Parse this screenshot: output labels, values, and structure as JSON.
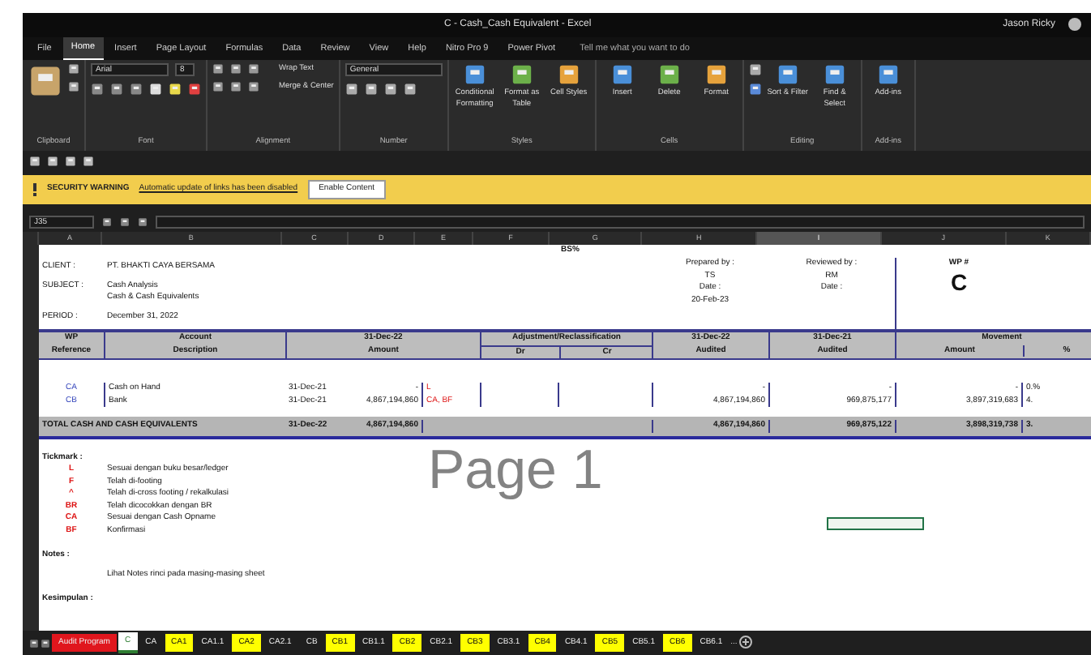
{
  "window": {
    "title": "C - Cash_Cash Equivalent - Excel",
    "user": "Jason Ricky"
  },
  "ribbon": {
    "tabs": [
      {
        "label": "File",
        "selected": false
      },
      {
        "label": "Home",
        "selected": true
      },
      {
        "label": "Insert",
        "selected": false
      },
      {
        "label": "Page Layout",
        "selected": false
      },
      {
        "label": "Formulas",
        "selected": false
      },
      {
        "label": "Data",
        "selected": false
      },
      {
        "label": "Review",
        "selected": false
      },
      {
        "label": "View",
        "selected": false
      },
      {
        "label": "Help",
        "selected": false
      },
      {
        "label": "Nitro Pro 9",
        "selected": false
      },
      {
        "label": "Power Pivot",
        "selected": false
      }
    ],
    "tell_me": "Tell me what you want to do",
    "font": "Arial",
    "font_size": "8",
    "number_format": "General",
    "groups": [
      {
        "label": "Clipboard",
        "kind": "clipboard"
      },
      {
        "label": "Font",
        "kind": "font"
      },
      {
        "label": "Alignment",
        "kind": "alignment",
        "buttons": [
          "Wrap Text",
          "Merge & Center"
        ]
      },
      {
        "label": "Number",
        "kind": "number"
      },
      {
        "label": "Styles",
        "kind": "big",
        "buttons": [
          "Conditional Formatting",
          "Format as Table",
          "Cell Styles"
        ]
      },
      {
        "label": "Cells",
        "kind": "big",
        "buttons": [
          "Insert",
          "Delete",
          "Format"
        ]
      },
      {
        "label": "Editing",
        "kind": "editing",
        "buttons": [
          "Sort & Filter",
          "Find & Select"
        ]
      },
      {
        "label": "Add-ins",
        "kind": "big",
        "buttons": [
          "Add-ins"
        ]
      }
    ]
  },
  "security_bar": {
    "title": "SECURITY WARNING",
    "message": "Automatic update of links has been disabled",
    "button": "Enable Content"
  },
  "name_box": "J35",
  "sheet": {
    "columns": [
      {
        "label": "A",
        "selected": false
      },
      {
        "label": "B",
        "selected": false
      },
      {
        "label": "C",
        "selected": false
      },
      {
        "label": "D",
        "selected": false
      },
      {
        "label": "E",
        "selected": false
      },
      {
        "label": "F",
        "selected": false
      },
      {
        "label": "G",
        "selected": false
      },
      {
        "label": "H",
        "selected": false
      },
      {
        "label": "I",
        "selected": true
      },
      {
        "label": "J",
        "selected": false
      },
      {
        "label": "K",
        "selected": false
      }
    ],
    "top_label": "BS%",
    "info": [
      {
        "label": "CLIENT :",
        "lines": [
          "PT. BHAKTI CAYA BERSAMA"
        ]
      },
      {
        "label": "SUBJECT :",
        "lines": [
          "Cash Analysis",
          "Cash & Cash Equivalents"
        ]
      },
      {
        "label": "PERIOD :",
        "lines": [
          "December 31, 2022"
        ]
      }
    ],
    "prepared": {
      "label": "Prepared by :",
      "name": "TS",
      "date_label": "Date :",
      "date": "20-Feb-23"
    },
    "reviewed": {
      "label": "Reviewed by :",
      "name": "RM",
      "date_label": "Date :"
    },
    "wp": {
      "label": "WP #",
      "value": "C"
    },
    "headers": {
      "ref": [
        "WP",
        "Reference"
      ],
      "desc": [
        "Account",
        "Description"
      ],
      "amount": [
        "31-Dec-22",
        "Amount"
      ],
      "adj": "Adjustment/Reclassification",
      "dr": "Dr",
      "cr": "Cr",
      "audited": [
        "31-Dec-22",
        "Audited"
      ],
      "prior": [
        "31-Dec-21",
        "Audited"
      ],
      "movement": "Movement",
      "mv_amount": "Amount",
      "mv_pct": "%"
    },
    "rows": [
      {
        "ref": "CA",
        "desc": "Cash on Hand",
        "date": "31-Dec-21",
        "amount": "-",
        "mark": "L",
        "audited": "-",
        "prior": "-",
        "movement": "-",
        "pct": "0.%"
      },
      {
        "ref": "CB",
        "desc": "Bank",
        "date": "31-Dec-21",
        "amount": "4,867,194,860",
        "mark": "CA, BF",
        "audited": "4,867,194,860",
        "prior": "969,875,177",
        "movement": "3,897,319,683",
        "pct": "4."
      }
    ],
    "total": {
      "label": "TOTAL CASH AND CASH EQUIVALENTS",
      "date": "31-Dec-22",
      "amount": "4,867,194,860",
      "audited": "4,867,194,860",
      "prior": "969,875,122",
      "movement": "3,898,319,738",
      "pct": "3."
    },
    "page_label": "Page 1",
    "tickmark_label": "Tickmark :",
    "tickmarks": [
      {
        "mark": "L",
        "text": "Sesuai dengan buku besar/ledger"
      },
      {
        "mark": "F",
        "text": "Telah di-footing"
      },
      {
        "mark": "^",
        "text": "Telah di-cross footing / rekalkulasi"
      },
      {
        "mark": "BR",
        "text": "Telah dicocokkan dengan BR"
      },
      {
        "mark": "CA",
        "text": "Sesuai dengan Cash Opname"
      },
      {
        "mark": "BF",
        "text": "Konfirmasi"
      }
    ],
    "notes_label": "Notes :",
    "notes": "Lihat Notes rinci pada masing-masing sheet",
    "conclusion_label": "Kesimpulan :"
  },
  "sheet_tabs": [
    {
      "label": "Audit Program",
      "color": "#e0161d",
      "selected": false
    },
    {
      "label": "C",
      "color": "#2e7d32",
      "selected": true
    },
    {
      "label": "CA",
      "color": "#1f1f1f",
      "selected": false
    },
    {
      "label": "CA1",
      "color": "#ffff00",
      "selected": false
    },
    {
      "label": "CA1.1",
      "color": "#1f1f1f",
      "selected": false
    },
    {
      "label": "CA2",
      "color": "#ffff00",
      "selected": false
    },
    {
      "label": "CA2.1",
      "color": "#1f1f1f",
      "selected": false
    },
    {
      "label": "CB",
      "color": "#1f1f1f",
      "selected": false
    },
    {
      "label": "CB1",
      "color": "#ffff00",
      "selected": false
    },
    {
      "label": "CB1.1",
      "color": "#1f1f1f",
      "selected": false
    },
    {
      "label": "CB2",
      "color": "#ffff00",
      "selected": false
    },
    {
      "label": "CB2.1",
      "color": "#1f1f1f",
      "selected": false
    },
    {
      "label": "CB3",
      "color": "#ffff00",
      "selected": false
    },
    {
      "label": "CB3.1",
      "color": "#1f1f1f",
      "selected": false
    },
    {
      "label": "CB4",
      "color": "#ffff00",
      "selected": false
    },
    {
      "label": "CB4.1",
      "color": "#1f1f1f",
      "selected": false
    },
    {
      "label": "CB5",
      "color": "#ffff00",
      "selected": false
    },
    {
      "label": "CB5.1",
      "color": "#1f1f1f",
      "selected": false
    },
    {
      "label": "CB6",
      "color": "#ffff00",
      "selected": false
    },
    {
      "label": "CB6.1",
      "color": "#1f1f1f",
      "selected": false
    }
  ],
  "more_tabs": "..."
}
